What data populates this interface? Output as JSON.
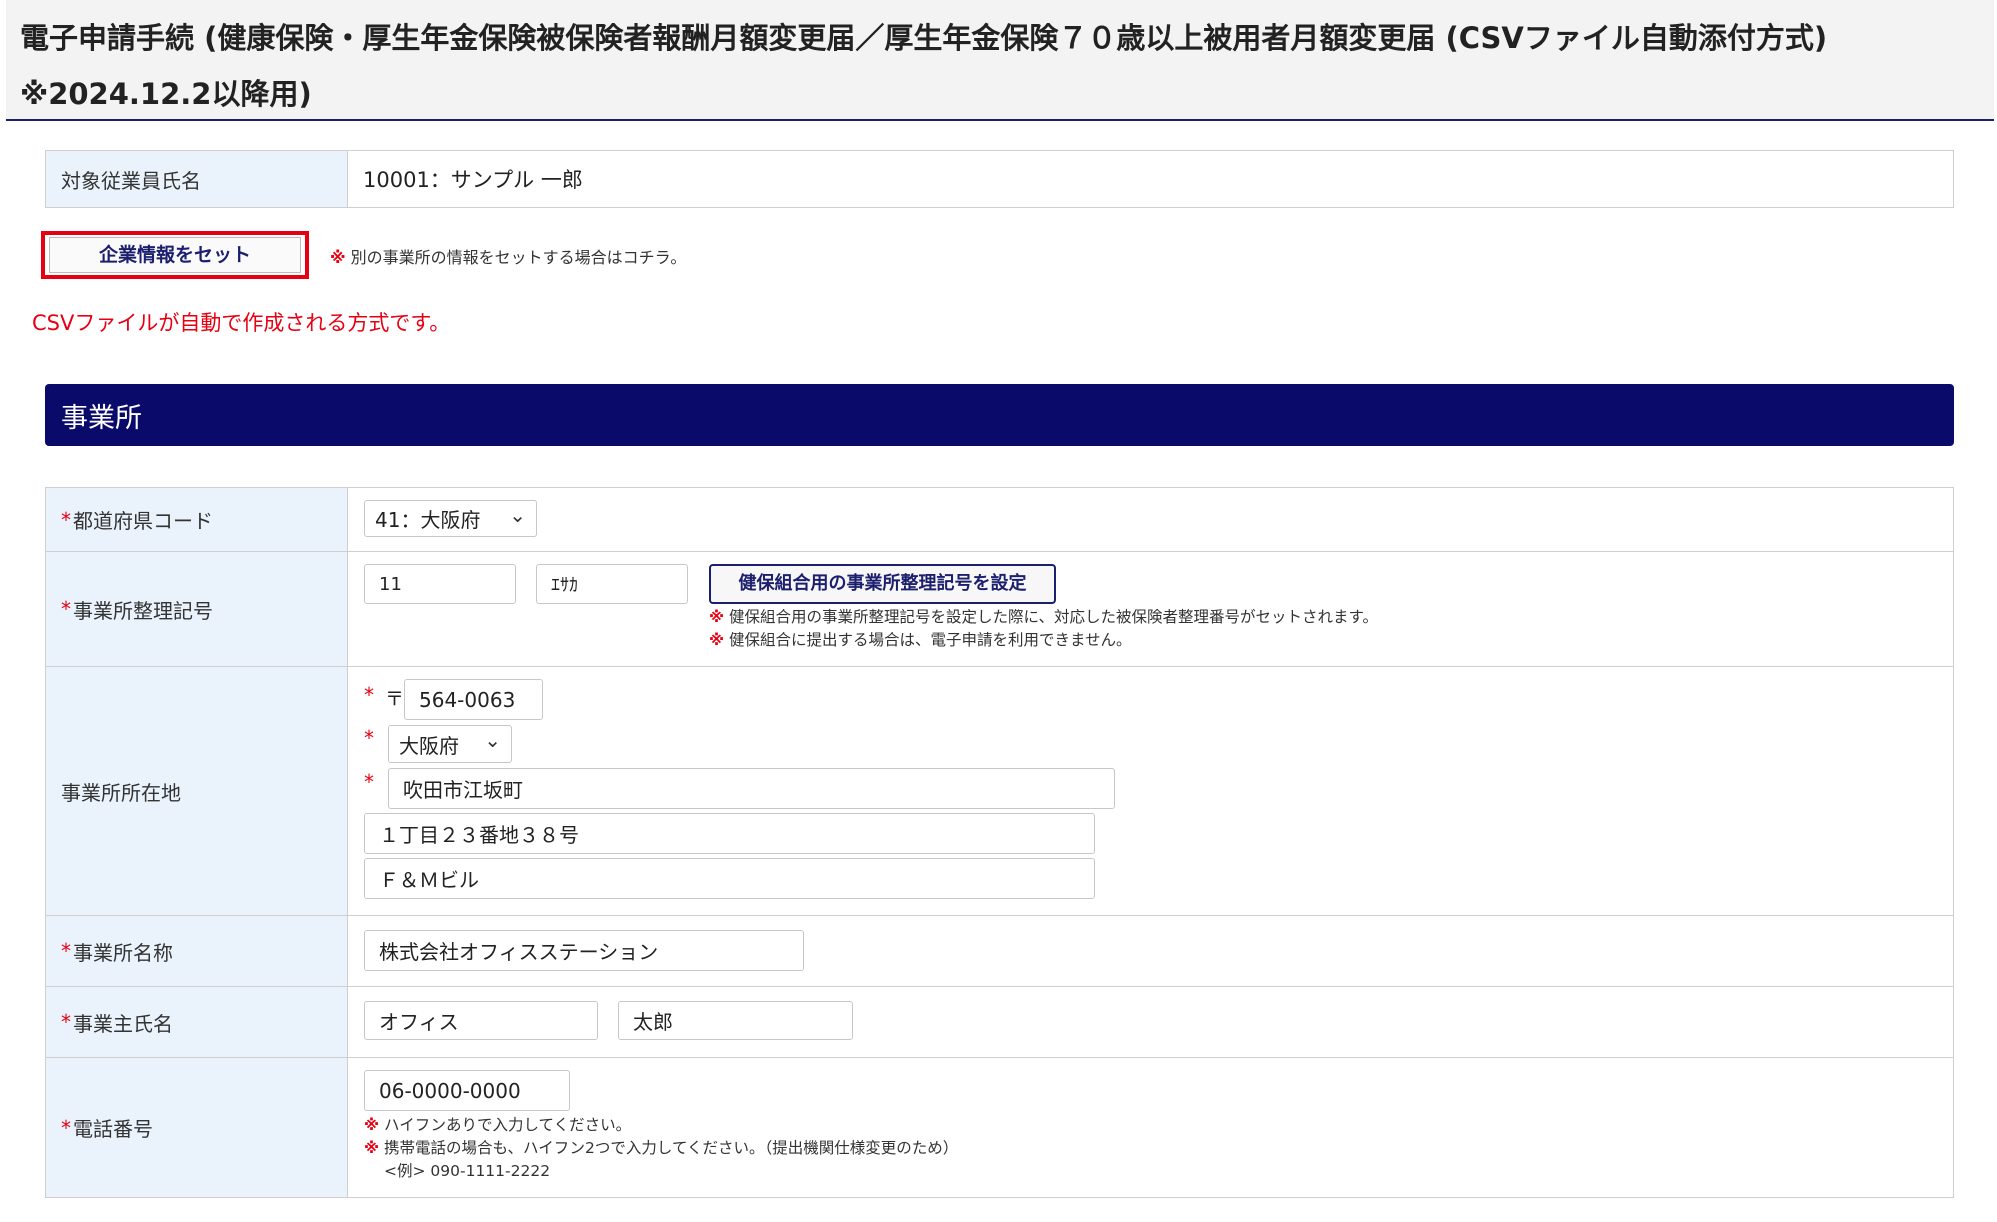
{
  "header": {
    "title": "電子申請手続 (健康保険・厚生年金保険被保険者報酬月額変更届／厚生年金保険７０歳以上被用者月額変更届 (CSVファイル自動添付方式) ※2024.12.2以降用)"
  },
  "employee": {
    "label": "対象従業員氏名",
    "value": "10001：サンプル 一郎"
  },
  "company_button": {
    "label": "企業情報をセット",
    "note_mark": "※",
    "note": "別の事業所の情報をセットする場合はコチラ。"
  },
  "csv_note": "CSVファイルが自動で作成される方式です。",
  "section": {
    "title": "事業所"
  },
  "form": {
    "required_mark": "*",
    "note_mark": "※",
    "prefecture_code": {
      "label": "都道府県コード",
      "value": "41：大阪府"
    },
    "office_code": {
      "label": "事業所整理記号",
      "value1": "11",
      "value2": "ｴｻｶ",
      "button": "健保組合用の事業所整理記号を設定",
      "note1": "健保組合用の事業所整理記号を設定した際に、対応した被保険者整理番号がセットされます。",
      "note2": "健保組合に提出する場合は、電子申請を利用できません。"
    },
    "address": {
      "label": "事業所所在地",
      "postal_mark": "〒",
      "postal": "564-0063",
      "prefecture": "大阪府",
      "city": "吹田市江坂町",
      "line1": "１丁目２３番地３８号",
      "line2": "Ｆ＆Ｍビル"
    },
    "office_name": {
      "label": "事業所名称",
      "value": "株式会社オフィスステーション"
    },
    "owner_name": {
      "label": "事業主氏名",
      "last": "オフィス",
      "first": "太郎"
    },
    "phone": {
      "label": "電話番号",
      "value": "06-0000-0000",
      "note1": "ハイフンありで入力してください。",
      "note2": "携帯電話の場合も、ハイフン2つで入力してください。（提出機関仕様変更のため）",
      "example": "<例> 090-1111-2222"
    }
  }
}
